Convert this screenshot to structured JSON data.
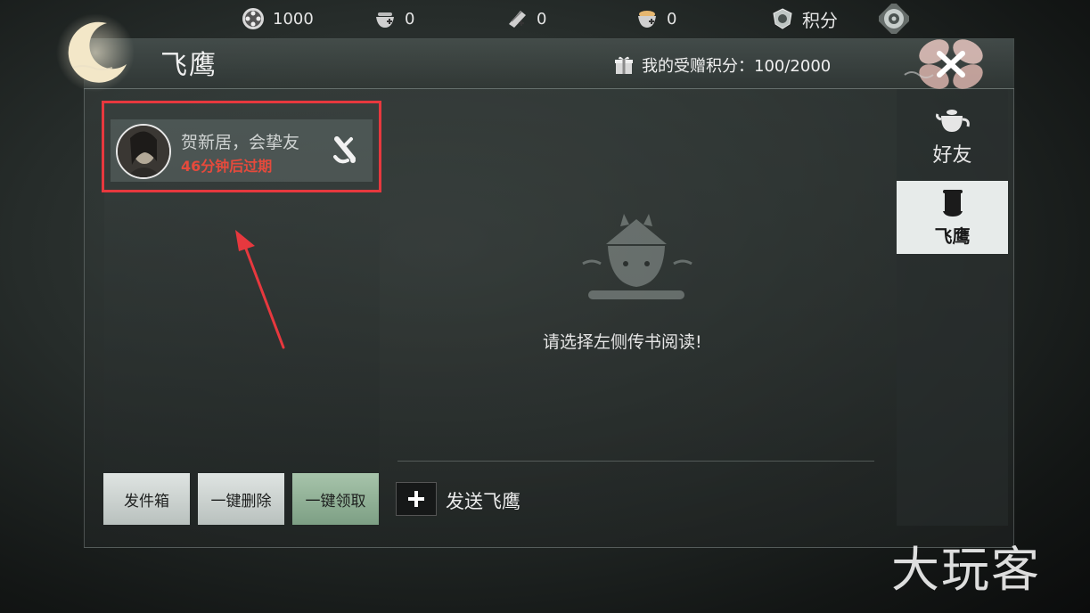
{
  "topbar": {
    "items": [
      {
        "icon": "film-reel-coin-icon",
        "value": "1000"
      },
      {
        "icon": "tea-bowl-plus-icon",
        "value": "0"
      },
      {
        "icon": "jade-plus-icon",
        "value": "0"
      },
      {
        "icon": "rice-bowl-plus-icon",
        "value": "0"
      },
      {
        "icon": "points-shield-icon",
        "value": "积分"
      },
      {
        "icon": "settings-emblem-icon",
        "value": ""
      }
    ]
  },
  "panel": {
    "title": "飞鹰",
    "gift_points_label": "我的受赠积分：100/2000",
    "gift_icon": "gift-box-icon"
  },
  "mail_list": {
    "items": [
      {
        "title": "贺新居，会挚友",
        "expire": "46分钟后过期",
        "icon": "scroll-letter-icon"
      }
    ]
  },
  "buttons": {
    "outbox": "发件箱",
    "delete_all": "一键删除",
    "claim_all": "一键领取"
  },
  "center": {
    "empty_text": "请选择左侧传书阅读!",
    "send_label": "发送飞鹰"
  },
  "tabs": [
    {
      "label": "好友",
      "icon": "teapot-icon"
    },
    {
      "label": "飞鹰",
      "icon": "scroll-icon",
      "active": true
    }
  ],
  "watermark": "大玩客",
  "colors": {
    "highlight": "#e7383e",
    "expire_text": "#e64a3c",
    "claim_button": "#8fb296"
  }
}
